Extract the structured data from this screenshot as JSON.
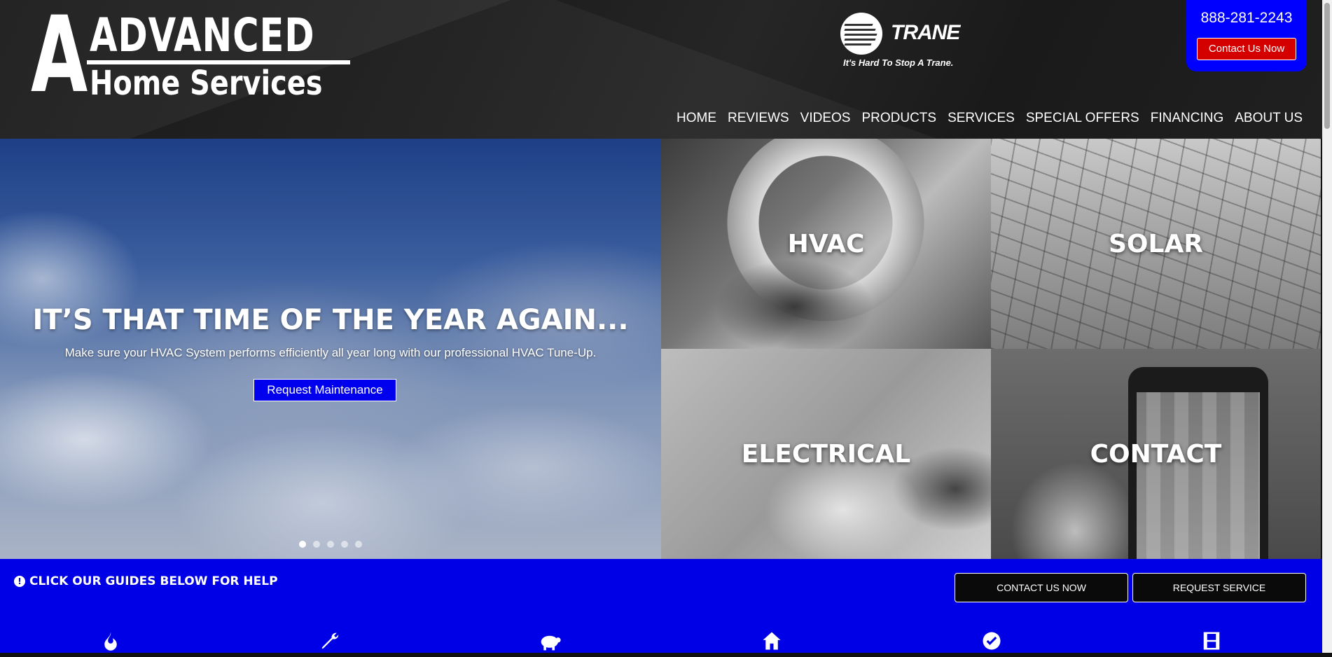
{
  "header": {
    "logo": {
      "letter": "A",
      "line1": "ADVANCED",
      "line2": "Home Services"
    },
    "trane": {
      "word": "TRANE",
      "tagline": "It's Hard To Stop A Trane."
    },
    "phone": "888-281-2243",
    "contact_button": "Contact Us Now",
    "nav": [
      "HOME",
      "REVIEWS",
      "VIDEOS",
      "PRODUCTS",
      "SERVICES",
      "SPECIAL OFFERS",
      "FINANCING",
      "ABOUT US"
    ]
  },
  "hero": {
    "title": "IT’S THAT TIME OF THE YEAR AGAIN...",
    "subtitle": "Make sure your HVAC System performs efficiently all year long with our professional HVAC Tune-Up.",
    "button": "Request Maintenance",
    "slides": 5,
    "active_slide": 1
  },
  "tiles": [
    {
      "label": "HVAC"
    },
    {
      "label": "SOLAR"
    },
    {
      "label": "ELECTRICAL"
    },
    {
      "label": "CONTACT"
    }
  ],
  "guides": {
    "title": "CLICK OUR GUIDES BELOW FOR HELP",
    "contact_button": "CONTACT US NOW",
    "request_button": "REQUEST SERVICE",
    "icons": [
      "fire-icon",
      "wrench-icon",
      "piggy-bank-icon",
      "home-icon",
      "check-badge-icon",
      "film-icon"
    ]
  },
  "colors": {
    "accent_blue": "#0000e6",
    "contact_red": "#d40000"
  }
}
